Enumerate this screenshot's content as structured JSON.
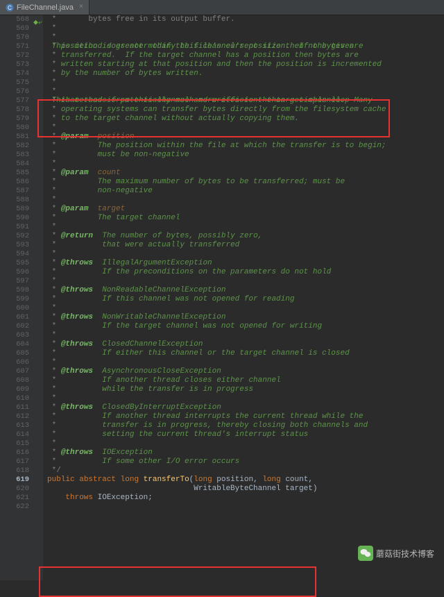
{
  "tab": {
    "title": "FileChannel.java",
    "icon": "java-class-icon",
    "close": "×"
  },
  "gutter_start": 568,
  "gutter_end": 622,
  "highlighted_line": 619,
  "lines": {
    "l568": " *       bytes free in its output buffer.",
    "l570": "<p> This method does not modify this channel's position.  If the given",
    "l571": "position is greater than the file's current size then no bytes are",
    "l572": "transferred.  If the target channel has a position then bytes are",
    "l573": "written starting at that position and then the position is incremented",
    "l574": "by the number of bytes written.",
    "l576": "<p> This method is potentially much more efficient than a simple loop",
    "l577": "that reads from this channel and writes to the target channel.  Many",
    "l578": "operating systems can transfer bytes directly from the filesystem cache",
    "l579": "to the target channel without actually copying them.  </p>"
  },
  "params": {
    "position": {
      "name": "position",
      "d1": "The position within the file at which the transfer is to begin;",
      "d2": "must be non-negative"
    },
    "count": {
      "name": "count",
      "d1": "The maximum number of bytes to be transferred; must be",
      "d2": "non-negative"
    },
    "target": {
      "name": "target",
      "d1": "The target channel"
    }
  },
  "ret": {
    "d1": "The number of bytes, possibly zero,",
    "d2": "that were actually transferred"
  },
  "throws": {
    "t1": {
      "n": "IllegalArgumentException",
      "d": "If the preconditions on the parameters do not hold"
    },
    "t2": {
      "n": "NonReadableChannelException",
      "d": "If this channel was not opened for reading"
    },
    "t3": {
      "n": "NonWritableChannelException",
      "d": "If the target channel was not opened for writing"
    },
    "t4": {
      "n": "ClosedChannelException",
      "d": "If either this channel or the target channel is closed"
    },
    "t5": {
      "n": "AsynchronousCloseException",
      "d1": "If another thread closes either channel",
      "d2": "while the transfer is in progress"
    },
    "t6": {
      "n": "ClosedByInterruptException",
      "d1": "If another thread interrupts the current thread while the",
      "d2": "transfer is in progress, thereby closing both channels and",
      "d3": "setting the current thread's interrupt status"
    },
    "t7": {
      "n": "IOException",
      "d": "If some other I/O error occurs"
    }
  },
  "sig": {
    "kw_public": "public",
    "kw_abstract": "abstract",
    "kw_long": "long",
    "name": "transferTo",
    "p1_t": "long",
    "p1_n": "position",
    "p2_t": "long",
    "p2_n": "count",
    "p3_t": "WritableByteChannel",
    "p3_n": "target",
    "kw_throws": "throws",
    "exc": "IOException"
  },
  "watermark": "蘑菇街技术博客",
  "tags": {
    "param": "@param",
    "return": "@return",
    "throws": "@throws"
  }
}
